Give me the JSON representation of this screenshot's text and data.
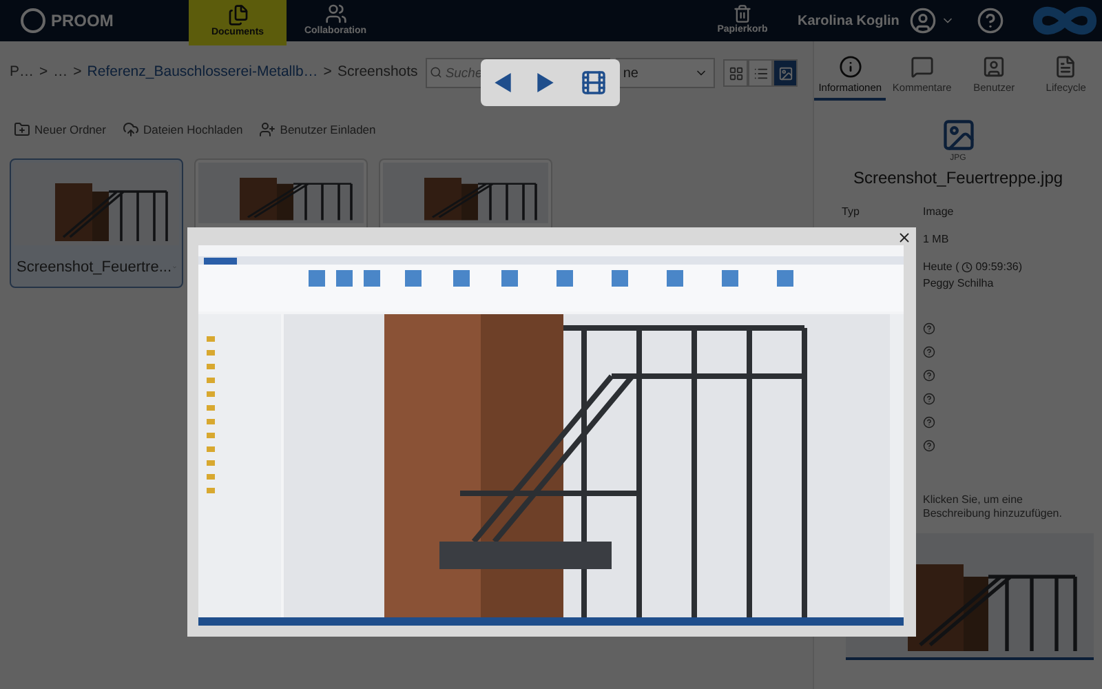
{
  "header": {
    "logo": "PROOM",
    "nav": [
      {
        "label": "Documents",
        "kind": "documents",
        "selected": true
      },
      {
        "label": "Collaboration",
        "kind": "collaboration",
        "selected": false
      }
    ],
    "trash": "Papierkorb",
    "user": "Karolina Koglin"
  },
  "breadcrumb": {
    "separator": ">",
    "items": [
      "P…",
      "…",
      "Referenz_Bauschlosserei-Metallb…",
      "Screenshots"
    ]
  },
  "search": {
    "placeholder": "Suche"
  },
  "sort": {
    "value": "ne"
  },
  "views": [
    {
      "kind": "grid",
      "selected": false
    },
    {
      "kind": "list",
      "selected": false
    },
    {
      "kind": "gallery",
      "selected": true
    }
  ],
  "actions": [
    {
      "kind": "folder",
      "label": "Neuer Ordner"
    },
    {
      "kind": "upload",
      "label": "Dateien Hochladen"
    },
    {
      "kind": "user",
      "label": "Benutzer Einladen"
    }
  ],
  "files": [
    {
      "name": "Screenshot_Feuertre...",
      "selected": true
    },
    {
      "selected": false
    },
    {
      "selected": false
    }
  ],
  "details": {
    "tabs": [
      {
        "label": "Informationen",
        "kind": "info",
        "selected": true
      },
      {
        "label": "Kommentare",
        "kind": "comments",
        "selected": false
      },
      {
        "label": "Benutzer",
        "kind": "users",
        "selected": false
      },
      {
        "label": "Lifecycle",
        "kind": "lifecycle",
        "selected": false
      }
    ],
    "file_type": "JPG",
    "file_name": "Screenshot_Feuertreppe.jpg",
    "rows": [
      {
        "label": "Typ",
        "value": "Image"
      },
      {
        "value": "1 MB"
      },
      {
        "value": "Heute (",
        "time": "09:59:36)",
        "user": "Peggy Schilha"
      }
    ],
    "description": "Klicken Sie, um eine Beschreibung hinzuzufügen."
  }
}
